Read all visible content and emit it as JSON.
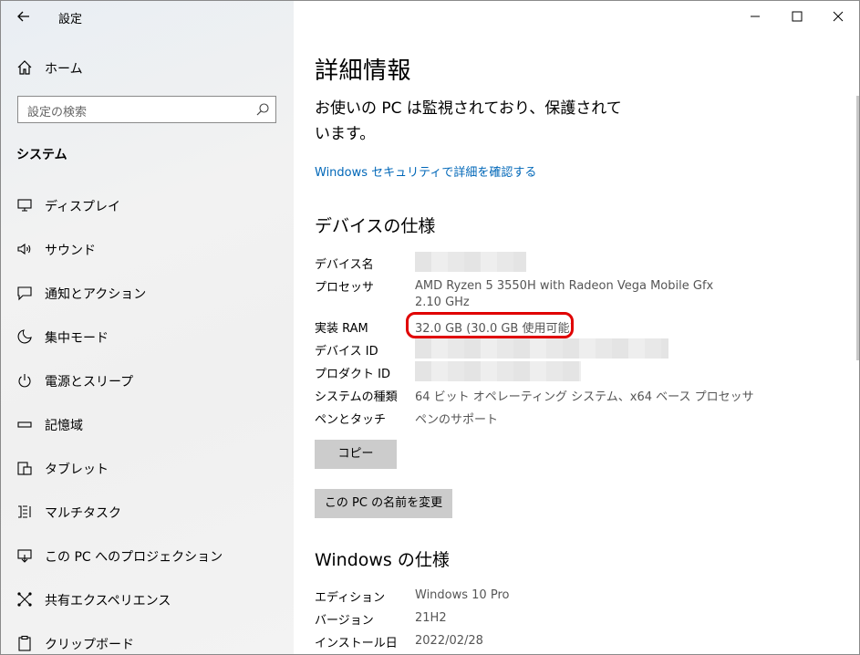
{
  "window": {
    "title": "設定"
  },
  "sidebar": {
    "home_label": "ホーム",
    "search_placeholder": "設定の検索",
    "section_title": "システム",
    "items": [
      {
        "label": "ディスプレイ",
        "icon": "display-icon"
      },
      {
        "label": "サウンド",
        "icon": "sound-icon"
      },
      {
        "label": "通知とアクション",
        "icon": "notification-icon"
      },
      {
        "label": "集中モード",
        "icon": "focus-moon-icon"
      },
      {
        "label": "電源とスリープ",
        "icon": "power-icon"
      },
      {
        "label": "記憶域",
        "icon": "storage-icon"
      },
      {
        "label": "タブレット",
        "icon": "tablet-icon"
      },
      {
        "label": "マルチタスク",
        "icon": "multitask-icon"
      },
      {
        "label": "この PC へのプロジェクション",
        "icon": "projection-icon"
      },
      {
        "label": "共有エクスペリエンス",
        "icon": "share-icon"
      },
      {
        "label": "クリップボード",
        "icon": "clipboard-icon"
      }
    ]
  },
  "main": {
    "title": "詳細情報",
    "protection_text": "お使いの PC は監視されており、保護されています。",
    "security_link": "Windows セキュリティで詳細を確認する",
    "device_spec_heading": "デバイスの仕様",
    "device_specs": [
      {
        "label": "デバイス名",
        "value": ""
      },
      {
        "label": "プロセッサ",
        "value": "AMD Ryzen 5 3550H with Radeon Vega Mobile Gfx",
        "value2": "2.10 GHz"
      },
      {
        "label": "実装 RAM",
        "value": "32.0 GB (30.0 GB 使用可能)"
      },
      {
        "label": "デバイス ID",
        "value": ""
      },
      {
        "label": "プロダクト ID",
        "value": ""
      },
      {
        "label": "システムの種類",
        "value": "64 ビット オペレーティング システム、x64 ベース プロセッサ"
      },
      {
        "label": "ペンとタッチ",
        "value": "ペンのサポート"
      }
    ],
    "copy_button": "コピー",
    "rename_button": "この PC の名前を変更",
    "windows_spec_heading": "Windows の仕様",
    "windows_specs": [
      {
        "label": "エディション",
        "value": "Windows 10 Pro"
      },
      {
        "label": "バージョン",
        "value": "21H2"
      },
      {
        "label": "インストール日",
        "value": "2022/02/28"
      }
    ]
  },
  "colors": {
    "link": "#0067b8",
    "highlight": "#e00000",
    "button": "#cccccc"
  }
}
